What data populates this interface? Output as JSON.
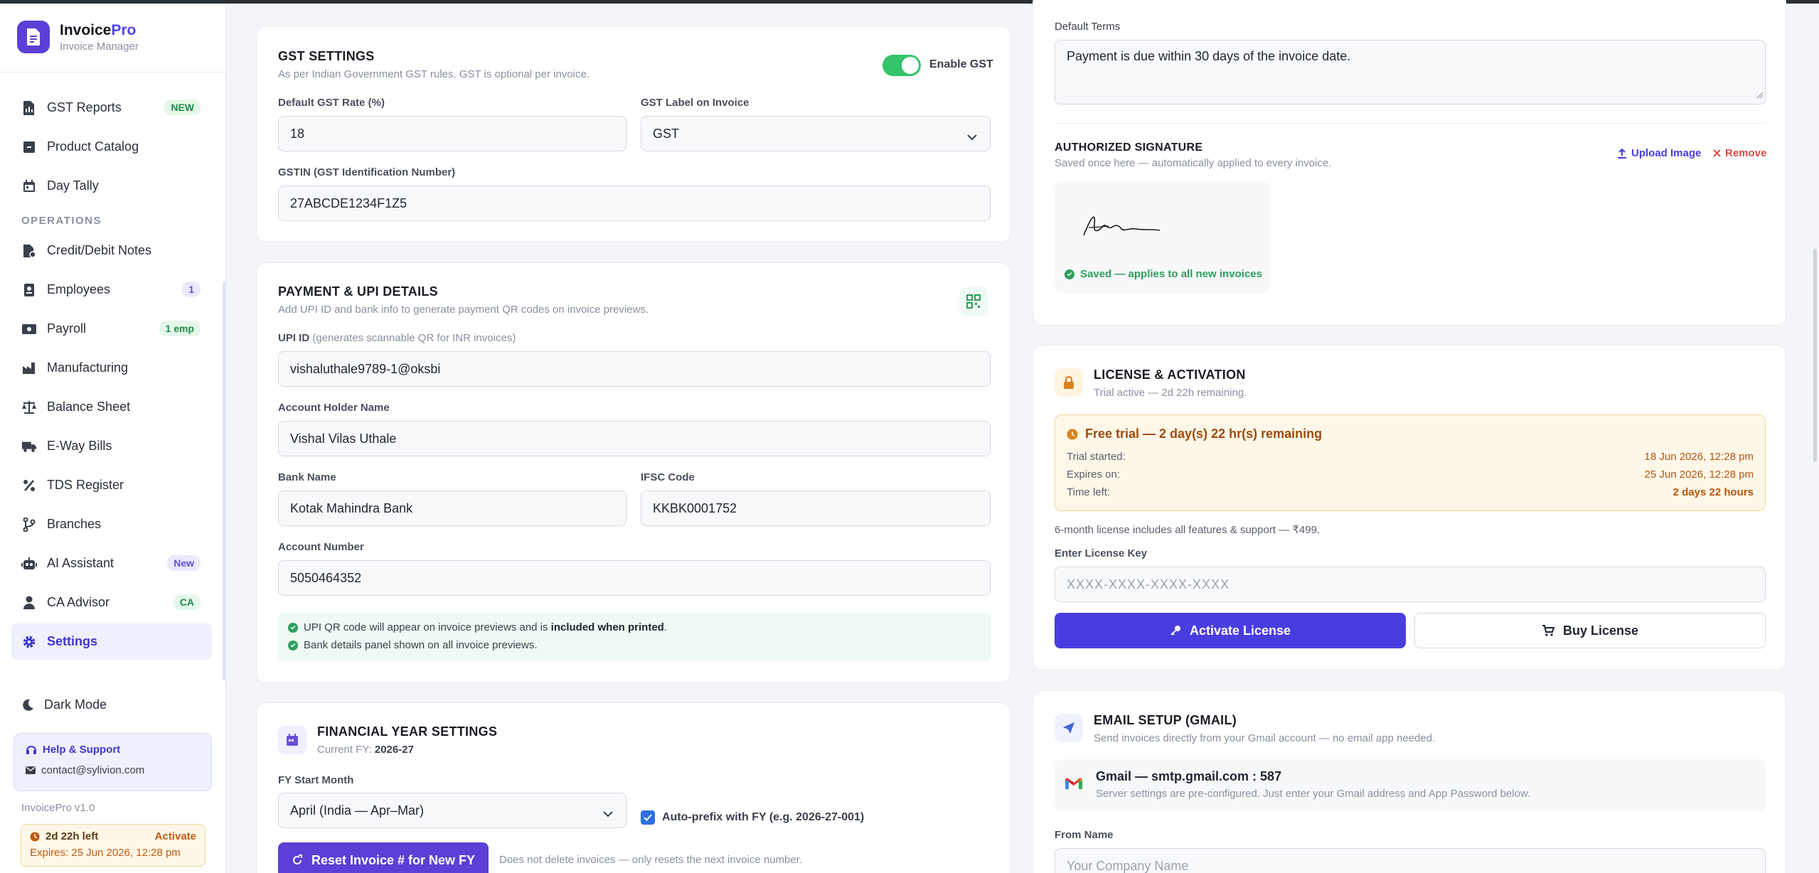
{
  "brand": {
    "name": "Invoice",
    "name_accent": "Pro",
    "subtitle": "Invoice Manager"
  },
  "sidebar": {
    "items": [
      {
        "label": "GST Reports",
        "badge": "NEW",
        "icon": "file-chart-icon"
      },
      {
        "label": "Product Catalog",
        "icon": "box-icon"
      },
      {
        "label": "Day Tally",
        "icon": "calendar-icon"
      }
    ],
    "section_operations": "OPERATIONS",
    "ops": [
      {
        "label": "Credit/Debit Notes",
        "icon": "note-icon"
      },
      {
        "label": "Employees",
        "badge": "1",
        "icon": "id-card-icon"
      },
      {
        "label": "Payroll",
        "badge": "1 emp",
        "icon": "money-icon"
      },
      {
        "label": "Manufacturing",
        "icon": "factory-icon"
      },
      {
        "label": "Balance Sheet",
        "icon": "scale-icon"
      },
      {
        "label": "E-Way Bills",
        "icon": "truck-icon"
      },
      {
        "label": "TDS Register",
        "icon": "percent-icon"
      },
      {
        "label": "Branches",
        "icon": "branch-icon"
      },
      {
        "label": "AI Assistant",
        "badge": "New",
        "icon": "robot-icon"
      },
      {
        "label": "CA Advisor",
        "badge": "CA",
        "icon": "person-icon"
      },
      {
        "label": "Settings",
        "icon": "gear-icon",
        "active": true
      }
    ],
    "dark_mode": "Dark Mode",
    "help_title": "Help & Support",
    "help_email": "contact@sylivion.com",
    "version": "InvoicePro v1.0",
    "trial_left": "2d 22h left",
    "trial_activate": "Activate",
    "trial_expires": "Expires: 25 Jun 2026, 12:28 pm"
  },
  "gst": {
    "title": "GST SETTINGS",
    "subtitle": "As per Indian Government GST rules. GST is optional per invoice.",
    "toggle_label": "Enable GST",
    "rate_label": "Default GST Rate (%)",
    "rate_value": "18",
    "label_label": "GST Label on Invoice",
    "label_value": "GST",
    "gstin_label": "GSTIN (GST Identification Number)",
    "gstin_value": "27ABCDE1234F1Z5"
  },
  "payment": {
    "title": "PAYMENT & UPI DETAILS",
    "subtitle": "Add UPI ID and bank info to generate payment QR codes on invoice previews.",
    "upi_label": "UPI ID",
    "upi_hint": "(generates scannable QR for INR invoices)",
    "upi_value": "vishaluthale9789-1@oksbi",
    "holder_label": "Account Holder Name",
    "holder_value": "Vishal Vilas Uthale",
    "bank_label": "Bank Name",
    "bank_value": "Kotak Mahindra Bank",
    "ifsc_label": "IFSC Code",
    "ifsc_value": "KKBK0001752",
    "acct_label": "Account Number",
    "acct_value": "5050464352",
    "note1_pre": "UPI QR code will appear on invoice previews and is ",
    "note1_bold": "included when printed",
    "note1_post": ".",
    "note2": "Bank details panel shown on all invoice previews."
  },
  "fy": {
    "title": "FINANCIAL YEAR SETTINGS",
    "current_prefix": "Current FY: ",
    "current_value": "2026-27",
    "start_label": "FY Start Month",
    "start_value": "April (India — Apr–Mar)",
    "autoprefix_label": "Auto-prefix with FY (e.g. 2026-27-001)",
    "reset_button": "Reset Invoice # for New FY",
    "reset_note": "Does not delete invoices — only resets the next invoice number."
  },
  "terms": {
    "label": "Default Terms",
    "value": "Payment is due within 30 days of the invoice date."
  },
  "signature": {
    "title": "AUTHORIZED SIGNATURE",
    "subtitle": "Saved once here — automatically applied to every invoice.",
    "upload": "Upload Image",
    "remove": "Remove",
    "saved": "Saved — applies to all new invoices"
  },
  "license": {
    "title": "LICENSE & ACTIVATION",
    "subtitle": "Trial active — 2d 22h remaining.",
    "trial_heading": "Free trial — 2 day(s) 22 hr(s) remaining",
    "started_k": "Trial started:",
    "started_v": "18 Jun 2026, 12:28 pm",
    "expires_k": "Expires on:",
    "expires_v": "25 Jun 2026, 12:28 pm",
    "left_k": "Time left:",
    "left_v": "2 days 22 hours",
    "price_note": "6-month license includes all features & support — ₹499.",
    "key_label": "Enter License Key",
    "key_placeholder": "XXXX-XXXX-XXXX-XXXX",
    "activate": "Activate License",
    "buy": "Buy License"
  },
  "email": {
    "title": "EMAIL SETUP (GMAIL)",
    "subtitle": "Send invoices directly from your Gmail account — no email app needed.",
    "server_title": "Gmail — smtp.gmail.com : 587",
    "server_sub": "Server settings are pre-configured. Just enter your Gmail address and App Password below.",
    "from_label": "From Name",
    "from_placeholder": "Your Company Name"
  },
  "colors": {
    "accent": "#4a3de0",
    "brand": "#5b3fd6",
    "success": "#34c26a",
    "warning_bg": "#fff8e8",
    "danger": "#e04848"
  }
}
